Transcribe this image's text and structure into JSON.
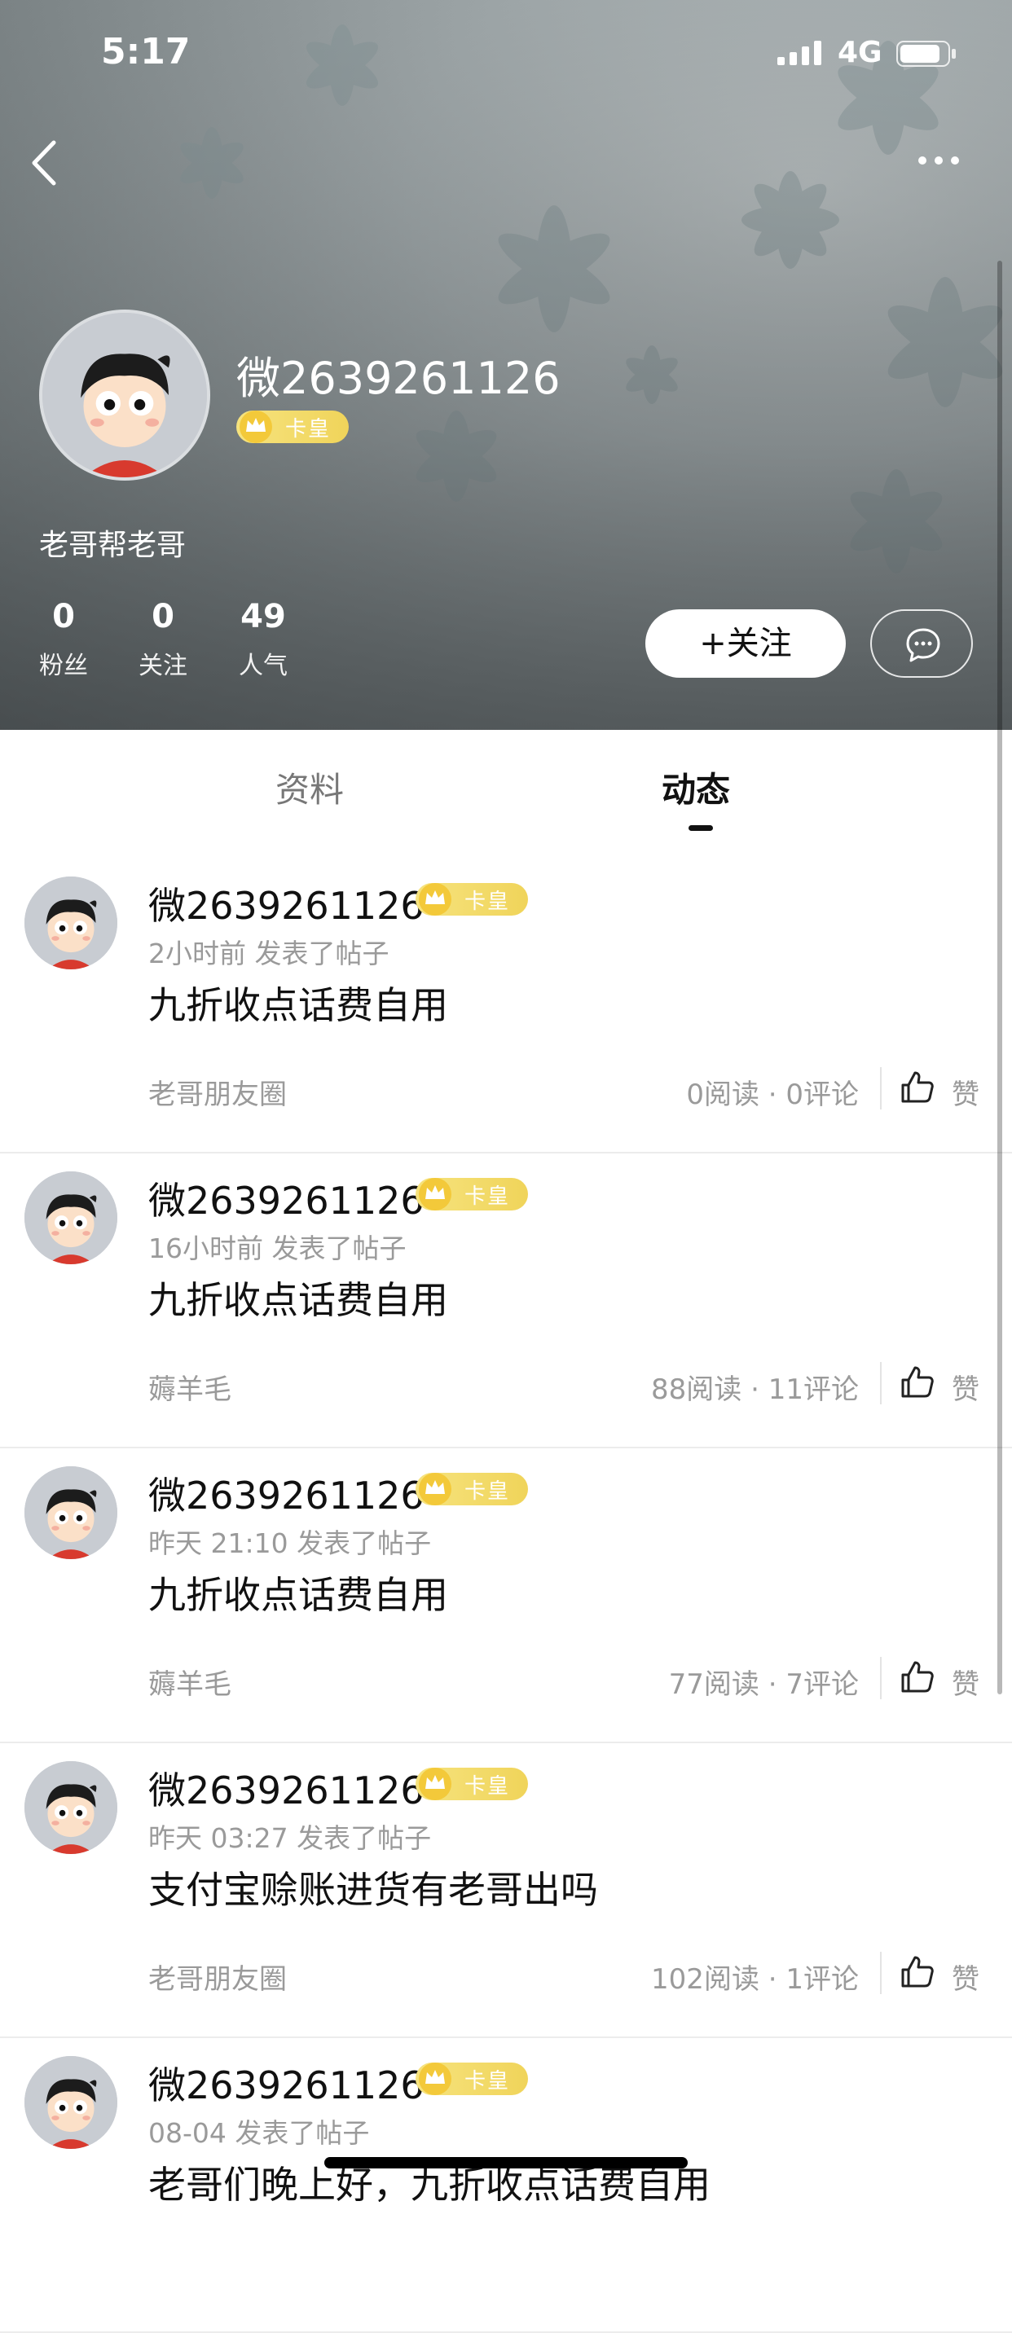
{
  "status_bar": {
    "time": "5:17",
    "network": "4G"
  },
  "profile": {
    "username": "微2639261126",
    "badge_text": "卡皇",
    "bio": "老哥帮老哥",
    "stats": [
      {
        "value": "0",
        "label": "粉丝"
      },
      {
        "value": "0",
        "label": "关注"
      },
      {
        "value": "49",
        "label": "人气"
      }
    ],
    "follow_label": "+关注"
  },
  "tabs": [
    {
      "label": "资料",
      "active": false
    },
    {
      "label": "动态",
      "active": true
    }
  ],
  "posts": [
    {
      "author": "微2639261126",
      "badge": "卡皇",
      "meta": "2小时前 发表了帖子",
      "content": "九折收点话费自用",
      "topic": "老哥朋友圈",
      "stats": "0阅读 · 0评论",
      "like_label": "赞"
    },
    {
      "author": "微2639261126",
      "badge": "卡皇",
      "meta": "16小时前 发表了帖子",
      "content": "九折收点话费自用",
      "topic": "薅羊毛",
      "stats": "88阅读 · 11评论",
      "like_label": "赞"
    },
    {
      "author": "微2639261126",
      "badge": "卡皇",
      "meta": "昨天 21:10 发表了帖子",
      "content": "九折收点话费自用",
      "topic": "薅羊毛",
      "stats": "77阅读 · 7评论",
      "like_label": "赞"
    },
    {
      "author": "微2639261126",
      "badge": "卡皇",
      "meta": "昨天 03:27 发表了帖子",
      "content": "支付宝赊账进货有老哥出吗",
      "topic": "老哥朋友圈",
      "stats": "102阅读 · 1评论",
      "like_label": "赞"
    },
    {
      "author": "微2639261126",
      "badge": "卡皇",
      "meta": "08-04 发表了帖子",
      "content": "老哥们晚上好，九折收点话费自用",
      "topic": "",
      "stats": "",
      "like_label": ""
    }
  ],
  "icons": {
    "back": "chevron-left-icon",
    "more": "more-dots-icon",
    "message": "chat-bubble-icon",
    "like": "thumbs-up-icon",
    "crown": "crown-icon"
  },
  "colors": {
    "badge_gold": "#f0d45a",
    "text_gray": "#9a9a9a",
    "active_tab": "#111111"
  }
}
